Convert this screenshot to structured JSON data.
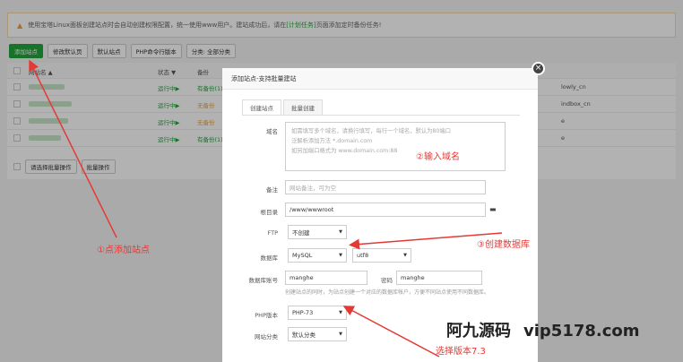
{
  "notice": {
    "warn_icon": "warning-icon",
    "text": "使用宝塔Linux面板创建站点时会自动创建权限配置，统一使用www用户。建站成功后，请在",
    "link": "[计划任务]",
    "text2": "页面添加定时备份任务!"
  },
  "toolbar": {
    "add_site": "添加站点",
    "edit_default_page": "修改默认页",
    "default_site": "默认站点",
    "php_cli": "PHP命令行版本",
    "category": "分类: 全部分类"
  },
  "table": {
    "headers": {
      "site": "网站名 ▲",
      "status": "状态 ▼",
      "backup": "备份"
    },
    "rows": [
      {
        "status": "运行中▶",
        "backup": "有备份(1)",
        "tail": "lowly_cn"
      },
      {
        "status": "运行中▶",
        "backup": "无备份",
        "tail": "indbox_cn"
      },
      {
        "status": "运行中▶",
        "backup": "无备份",
        "tail": "e"
      },
      {
        "status": "运行中▶",
        "backup": "有备份(1)",
        "tail": "e"
      }
    ],
    "batch_select": "请选择批量操作",
    "batch_btn": "批量操作"
  },
  "modal": {
    "title": "添加站点-支持批量建站",
    "tabs": [
      "创建站点",
      "批量创建"
    ],
    "domain_label": "域名",
    "domain_hint1": "如需填写多个域名，请换行填写，每行一个域名，默认为80端口",
    "domain_hint2": "泛解析添加方法 *.domain.com",
    "domain_hint3": "如另加端口格式为 www.domain.com:88",
    "remark_label": "备注",
    "remark_placeholder": "网站备注，可为空",
    "root_label": "根目录",
    "root_value": "/www/wwwroot",
    "ftp_label": "FTP",
    "ftp_value": "不创建",
    "db_label": "数据库",
    "db_value": "MySQL",
    "charset_value": "utf8",
    "db_account_label": "数据库账号",
    "db_user": "manghe",
    "pwd_label": "密码",
    "db_pwd": "manghe",
    "db_hint": "创建站点的同时，为站点创建一个对应的数据库帐户，方便不同站点使用不同数据库。",
    "php_label": "PHP版本",
    "php_value": "PHP-73",
    "cat_label": "网站分类",
    "cat_value": "默认分类"
  },
  "annotations": {
    "a1": "①点添加站点",
    "a2": "②输入域名",
    "a3": "③创建数据库",
    "a4": "选择版本7.3"
  },
  "watermark": {
    "cn": "阿九源码",
    "url": "vip5178.com"
  },
  "colors": {
    "accent": "#20a53a",
    "annotation": "#e53935"
  }
}
